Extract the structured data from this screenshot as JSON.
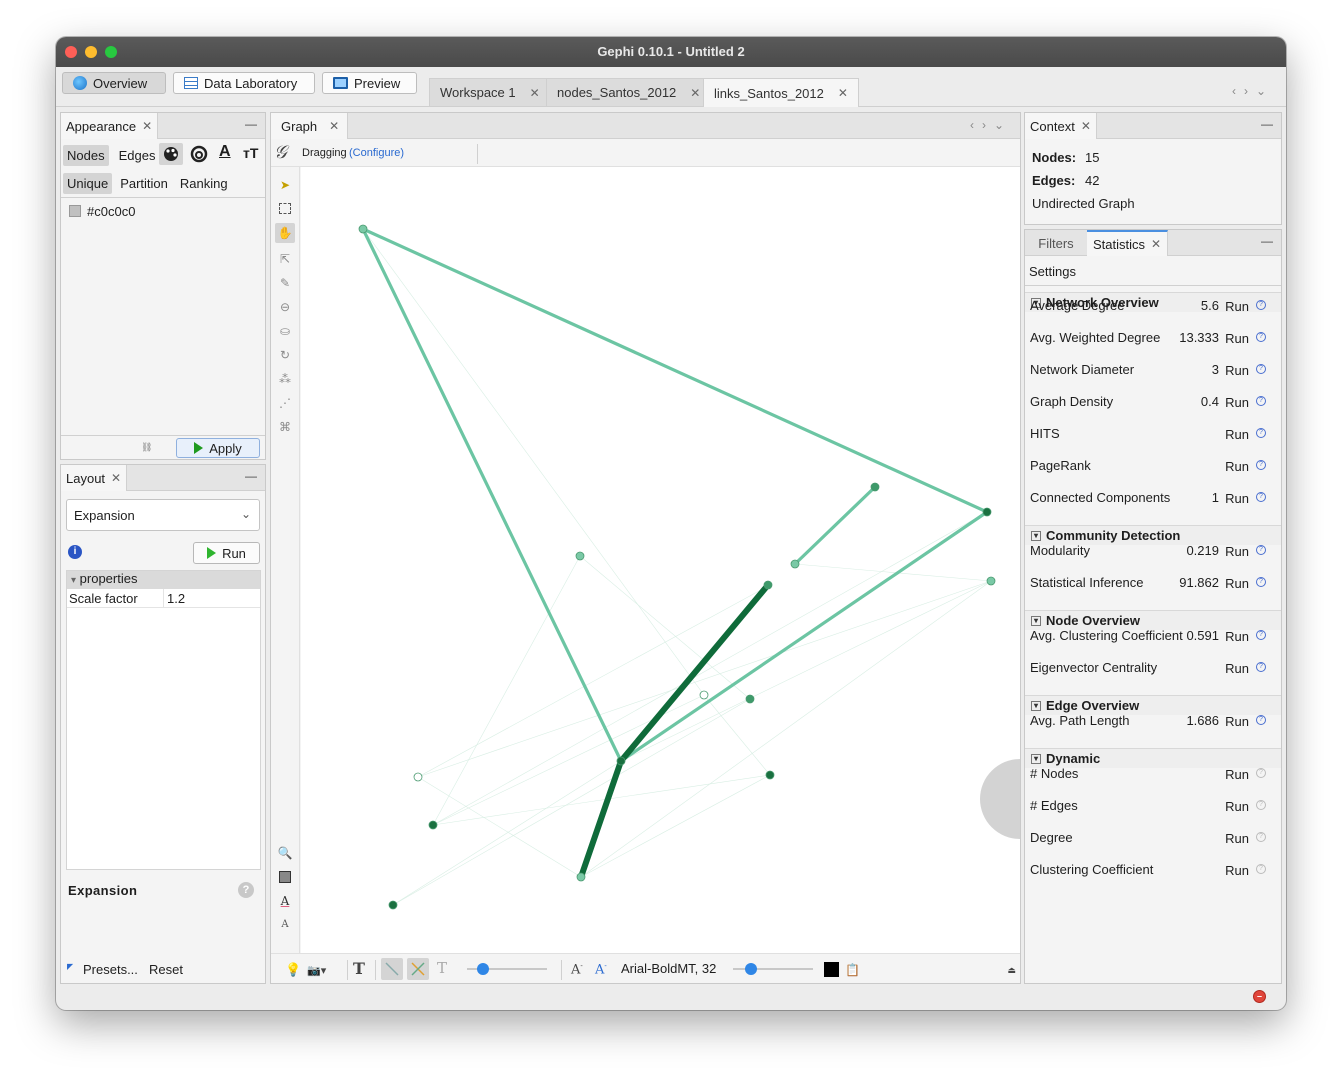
{
  "window": {
    "title": "Gephi 0.10.1 - Untitled 2"
  },
  "toolbar": {
    "modes": [
      {
        "label": "Overview",
        "icon": "globe-icon",
        "active": true
      },
      {
        "label": "Data Laboratory",
        "icon": "table-icon",
        "active": false
      },
      {
        "label": "Preview",
        "icon": "monitor-icon",
        "active": false
      }
    ],
    "workspaces": [
      {
        "label": "Workspace 1",
        "active": false
      },
      {
        "label": "nodes_Santos_2012",
        "active": false
      },
      {
        "label": "links_Santos_2012",
        "active": true
      }
    ]
  },
  "appearance": {
    "tab_label": "Appearance",
    "targets": [
      "Nodes",
      "Edges"
    ],
    "modes": [
      "Unique",
      "Partition",
      "Ranking"
    ],
    "color_value": "#c0c0c0",
    "apply_label": "Apply"
  },
  "layout": {
    "tab_label": "Layout",
    "selected": "Expansion",
    "run_label": "Run",
    "section": "properties",
    "prop_name": "Scale factor",
    "prop_value": "1.2",
    "desc_title": "Expansion",
    "presets_label": "Presets...",
    "reset_label": "Reset"
  },
  "graph": {
    "tab_label": "Graph",
    "tool_label": "Dragging",
    "configure_label": "(Configure)",
    "font_label": "Arial-BoldMT, 32",
    "edge_colors": {
      "light": "#6cc5a3",
      "dark": "#0f6b3a"
    },
    "node_colors": {
      "light": "#7ac9a6",
      "mid": "#3e9a6a",
      "dark": "#1a7040",
      "white": "#ffffff"
    }
  },
  "context": {
    "tab_label": "Context",
    "nodes_label": "Nodes:",
    "nodes_value": "15",
    "edges_label": "Edges:",
    "edges_value": "42",
    "graph_type": "Undirected Graph"
  },
  "stats": {
    "filters_label": "Filters",
    "statistics_label": "Statistics",
    "settings_label": "Settings",
    "run_label": "Run",
    "sections": [
      {
        "title": "Network Overview",
        "rows": [
          {
            "label": "Average Degree",
            "value": "5.6"
          },
          {
            "label": "Avg. Weighted Degree",
            "value": "13.333"
          },
          {
            "label": "Network Diameter",
            "value": "3"
          },
          {
            "label": "Graph Density",
            "value": "0.4"
          },
          {
            "label": "HITS",
            "value": ""
          },
          {
            "label": "PageRank",
            "value": ""
          },
          {
            "label": "Connected Components",
            "value": "1"
          }
        ]
      },
      {
        "title": "Community Detection",
        "rows": [
          {
            "label": "Modularity",
            "value": "0.219"
          },
          {
            "label": "Statistical Inference",
            "value": "91.862"
          }
        ]
      },
      {
        "title": "Node Overview",
        "rows": [
          {
            "label": "Avg. Clustering Coefficient",
            "value": "0.591"
          },
          {
            "label": "Eigenvector Centrality",
            "value": ""
          }
        ]
      },
      {
        "title": "Edge Overview",
        "rows": [
          {
            "label": "Avg. Path Length",
            "value": "1.686"
          }
        ]
      },
      {
        "title": "Dynamic",
        "rows": [
          {
            "label": "# Nodes",
            "value": ""
          },
          {
            "label": "# Edges",
            "value": ""
          },
          {
            "label": "Degree",
            "value": ""
          },
          {
            "label": "Clustering Coefficient",
            "value": ""
          }
        ]
      }
    ]
  }
}
